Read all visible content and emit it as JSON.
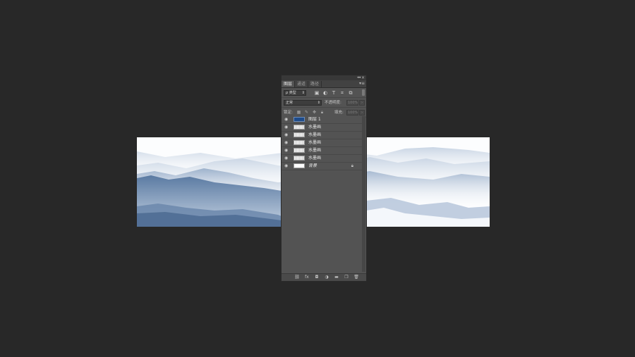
{
  "panel": {
    "tabs": [
      {
        "label": "图层",
        "active": true
      },
      {
        "label": "通道",
        "active": false
      },
      {
        "label": "路径",
        "active": false
      }
    ],
    "collapse_icon": "double-arrow-icon",
    "close_icon": "close-icon",
    "menu_icon": "panel-menu-icon"
  },
  "filter": {
    "kind_label": "ρ 类型",
    "icons": [
      "image-filter-icon",
      "adjustment-filter-icon",
      "type-filter-icon",
      "shape-filter-icon",
      "smart-object-filter-icon"
    ]
  },
  "blend": {
    "mode": "正常",
    "opacity_label": "不透明度:",
    "opacity_value": "100%"
  },
  "lock": {
    "label": "锁定:",
    "fill_label": "填充:",
    "fill_value": "100%"
  },
  "layers": [
    {
      "name": "图层 1",
      "thumb": "blue",
      "visible": true
    },
    {
      "name": "水墨画",
      "thumb": "wave",
      "visible": true
    },
    {
      "name": "水墨画",
      "thumb": "wave",
      "visible": true
    },
    {
      "name": "水墨画",
      "thumb": "wave",
      "visible": true
    },
    {
      "name": "水墨画",
      "thumb": "wave",
      "visible": true
    },
    {
      "name": "水墨画",
      "thumb": "wave",
      "visible": true
    },
    {
      "name": "背景",
      "thumb": "white",
      "visible": true,
      "locked": true
    }
  ],
  "bottom_icons": [
    "link-layers-icon",
    "fx-icon",
    "mask-icon",
    "adjustment-layer-icon",
    "group-folder-icon",
    "new-layer-icon",
    "trash-icon"
  ],
  "colors": {
    "workspace_bg": "#282828",
    "panel_bg": "#535353",
    "layer_thumb_blue": "#1e4b8a",
    "mountain_dark": "#4f6d94",
    "mountain_light": "#b9c8dc"
  }
}
